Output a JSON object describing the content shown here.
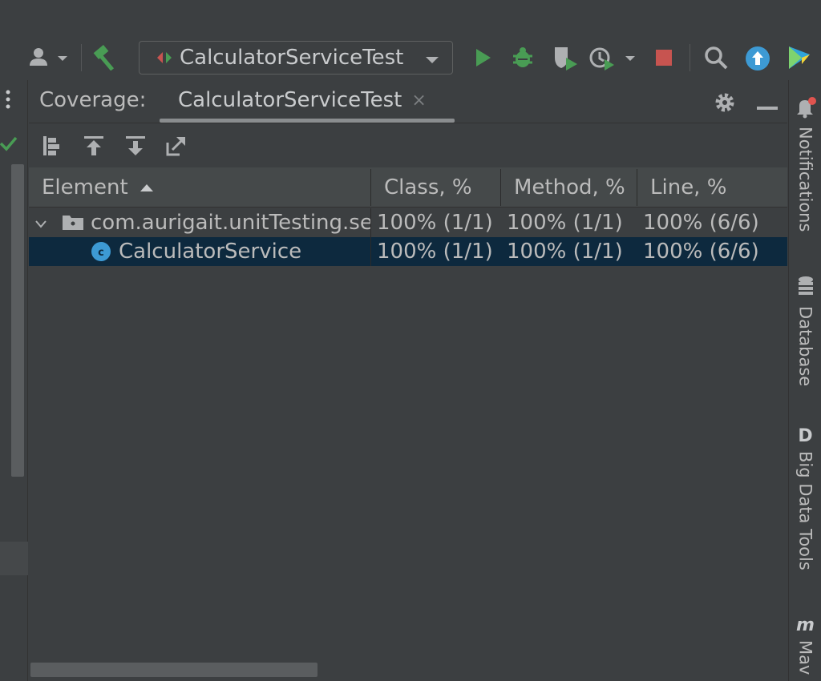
{
  "toolbar": {
    "run_config_label": "CalculatorServiceTest",
    "icons": [
      "account-icon",
      "build-hammer-icon",
      "run-icon",
      "debug-icon",
      "coverage-icon",
      "profiler-icon",
      "stop-icon",
      "search-icon",
      "update-icon",
      "plugin-logo-icon"
    ]
  },
  "panel": {
    "title": "Coverage:",
    "tab_label": "CalculatorServiceTest",
    "tab_close": "×"
  },
  "table": {
    "columns": [
      "Element",
      "Class, %",
      "Method, %",
      "Line, %"
    ],
    "rows": [
      {
        "name": "com.aurigait.unitTesting.se",
        "cls": "100% (1/1)",
        "method": "100% (1/1)",
        "line": "100% (6/6)"
      },
      {
        "name": "CalculatorService",
        "cls": "100% (1/1)",
        "method": "100% (1/1)",
        "line": "100% (6/6)"
      }
    ]
  },
  "right_tools": {
    "notifications": "Notifications",
    "database": "Database",
    "big_data_tools_glyph": "D",
    "big_data_tools": "Big Data Tools",
    "maven_glyph": "m",
    "maven": "Mav"
  },
  "colors": {
    "accent_green": "#499c54",
    "stop_red": "#c75450",
    "selection": "#0d293e",
    "class_icon_blue": "#3d9ad4"
  }
}
